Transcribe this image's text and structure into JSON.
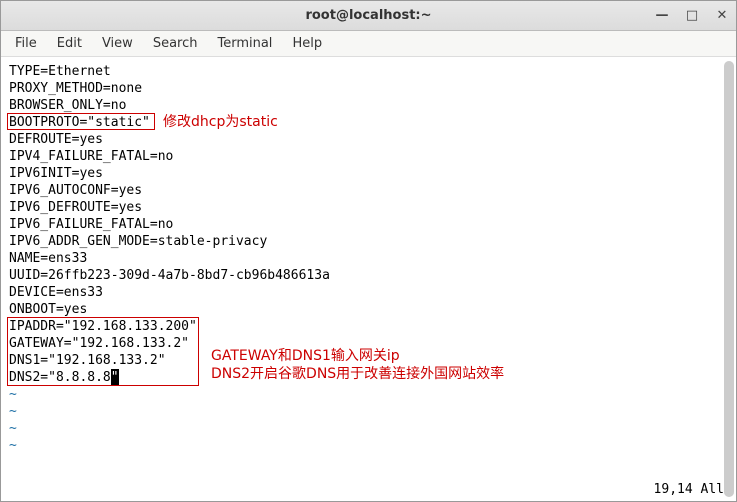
{
  "window": {
    "title": "root@localhost:~"
  },
  "menu": {
    "file": "File",
    "edit": "Edit",
    "view": "View",
    "search": "Search",
    "terminal": "Terminal",
    "help": "Help"
  },
  "config": {
    "line1": "TYPE=Ethernet",
    "line2": "PROXY_METHOD=none",
    "line3": "BROWSER_ONLY=no",
    "line4": "BOOTPROTO=\"static\"",
    "line5": "DEFROUTE=yes",
    "line6": "IPV4_FAILURE_FATAL=no",
    "line7": "IPV6INIT=yes",
    "line8": "IPV6_AUTOCONF=yes",
    "line9": "IPV6_DEFROUTE=yes",
    "line10": "IPV6_FAILURE_FATAL=no",
    "line11": "IPV6_ADDR_GEN_MODE=stable-privacy",
    "line12": "NAME=ens33",
    "line13": "UUID=26ffb223-309d-4a7b-8bd7-cb96b486613a",
    "line14": "DEVICE=ens33",
    "line15": "ONBOOT=yes",
    "line16": "IPADDR=\"192.168.133.200\"",
    "line17": "GATEWAY=\"192.168.133.2\"",
    "line18": "DNS1=\"192.168.133.2\"",
    "line19_pre": "DNS2=\"8.8.8.8",
    "line19_cursor": "\"",
    "tilde": "~"
  },
  "annotations": {
    "a1": "修改dhcp为static",
    "a2_line1": "GATEWAY和DNS1输入网关ip",
    "a2_line2": "DNS2开启谷歌DNS用于改善连接外国网站效率"
  },
  "status": {
    "position": "19,14",
    "mode": "All"
  }
}
